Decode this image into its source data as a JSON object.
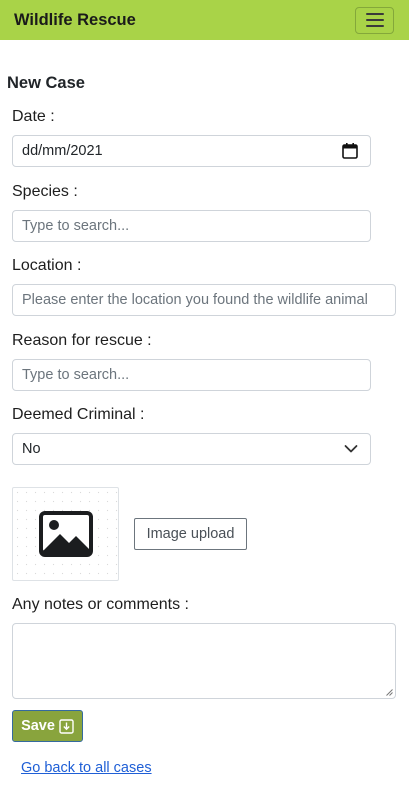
{
  "navbar": {
    "brand": "Wildlife Rescue",
    "menu_icon": "hamburger-menu-icon"
  },
  "form": {
    "heading": "New Case",
    "date": {
      "label": "Date :",
      "value": "dd/mm/2021",
      "icon": "calendar-icon"
    },
    "species": {
      "label": "Species :",
      "placeholder": "Type to search..."
    },
    "location": {
      "label": "Location :",
      "placeholder": "Please enter the location you found the wildlife animal"
    },
    "reason": {
      "label": "Reason for rescue :",
      "placeholder": "Type to search..."
    },
    "criminal": {
      "label": "Deemed Criminal :",
      "value": "No",
      "icon": "chevron-down-icon"
    },
    "image": {
      "icon": "image-placeholder-icon",
      "upload_label": "Image upload"
    },
    "notes": {
      "label": "Any notes or comments :",
      "value": ""
    },
    "save_label": "Save",
    "save_icon": "save-download-icon",
    "back_link": "Go back to all cases"
  },
  "colors": {
    "navbar": "#a9d348",
    "save_button": "#89a43d",
    "link": "#1f5fd6"
  }
}
